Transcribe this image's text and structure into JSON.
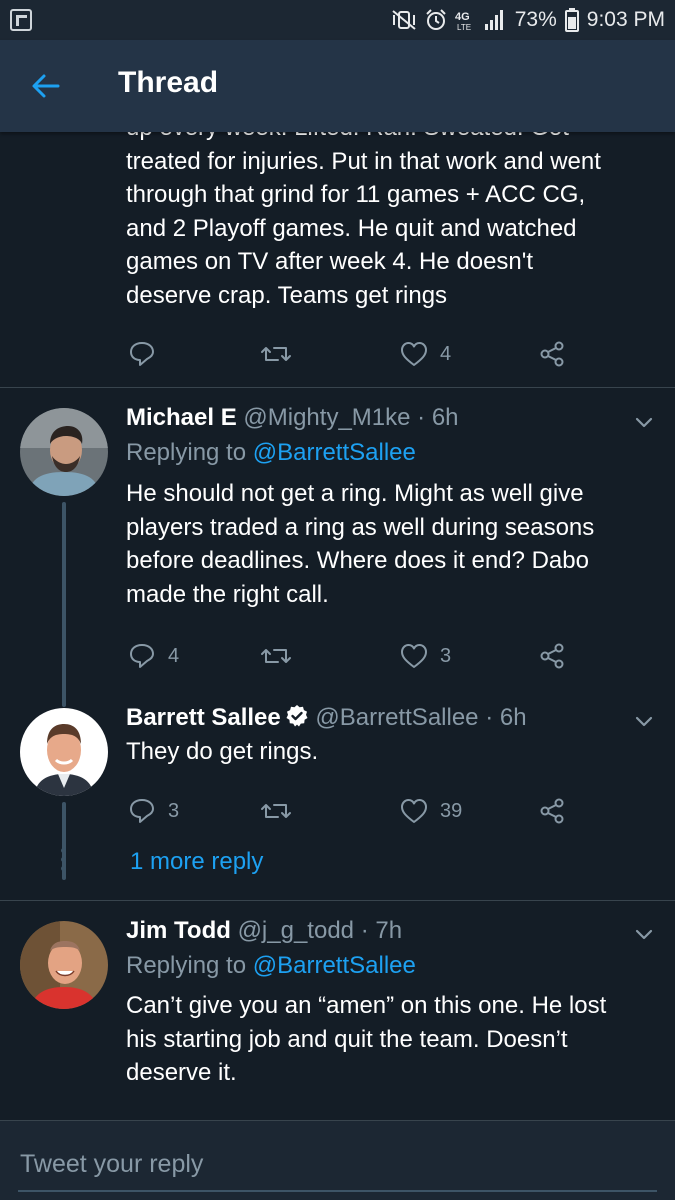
{
  "status_bar": {
    "battery": "73%",
    "time": "9:03 PM",
    "network": "4G LTE"
  },
  "header": {
    "title": "Thread"
  },
  "tweets": [
    {
      "body_lines": [
        "up every week. Lifted. Ran. Sweated. Got",
        "treated for injuries. Put in that work and went",
        "through that grind for 11 games + ACC CG,",
        "and 2 Playoff games. He quit and watched",
        "games on TV after week 4. He doesn't",
        "deserve crap. Teams get rings"
      ],
      "reply_count": "",
      "retweet_count": "",
      "like_count": "4"
    },
    {
      "name": "Michael E",
      "handle": "@Mighty_M1ke",
      "time": "· 6h",
      "replying_prefix": "Replying to",
      "replying_to": "@BarrettSallee",
      "body_lines": [
        "He should not get a ring. Might as well give",
        "players traded a ring as well during seasons",
        "before deadlines. Where does it end? Dabo",
        "made the right call."
      ],
      "reply_count": "4",
      "retweet_count": "",
      "like_count": "3"
    },
    {
      "name": "Barrett Sallee",
      "verified": true,
      "handle": "@BarrettSallee",
      "time": "· 6h",
      "body_lines": [
        "They do get rings."
      ],
      "reply_count": "3",
      "retweet_count": "",
      "like_count": "39"
    },
    {
      "name": "Jim Todd",
      "handle": "@j_g_todd",
      "time": "· 7h",
      "replying_prefix": "Replying to",
      "replying_to": "@BarrettSallee",
      "body_lines": [
        "Can’t give you an “amen” on this one. He lost",
        "his starting job and quit the team. Doesn’t",
        "deserve it."
      ]
    }
  ],
  "more_replies": "1 more reply",
  "composer": {
    "placeholder": "Tweet your reply"
  },
  "colors": {
    "background": "#141d26",
    "header_background": "#243447",
    "accent": "#1da1f2",
    "secondary_text": "#8899a6",
    "divider": "#38444d"
  },
  "icons": [
    "back-arrow-icon",
    "reply-icon",
    "retweet-icon",
    "like-icon",
    "share-icon",
    "chevron-down-icon",
    "verified-badge-icon"
  ]
}
